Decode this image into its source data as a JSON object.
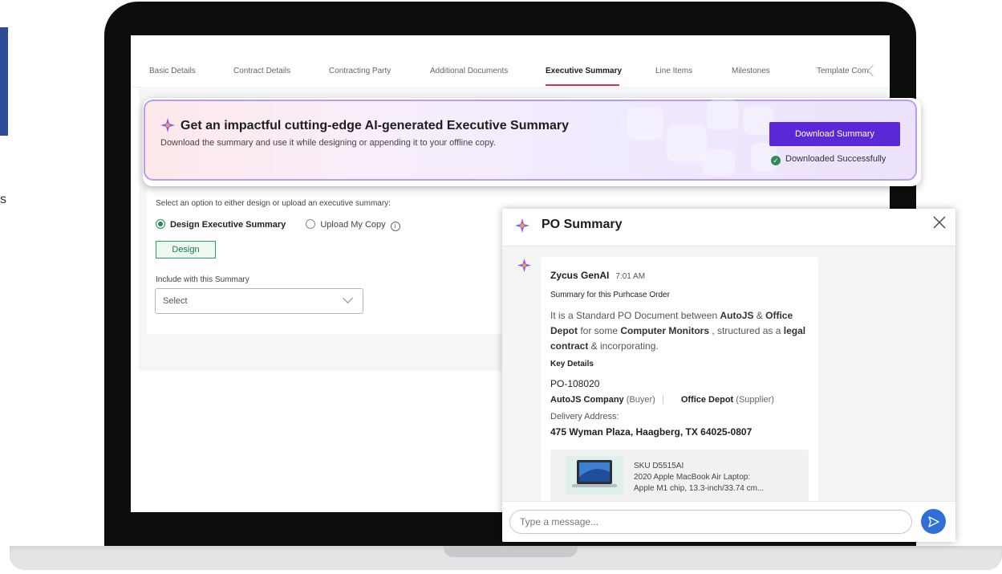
{
  "tabs": [
    {
      "label": "Basic Details"
    },
    {
      "label": "Contract Details"
    },
    {
      "label": "Contracting Party"
    },
    {
      "label": "Additional Documents"
    },
    {
      "label": "Executive Summary"
    },
    {
      "label": "Line Items"
    },
    {
      "label": "Milestones"
    },
    {
      "label": "Template Com"
    }
  ],
  "active_tab": "Executive Summary",
  "banner": {
    "title": "Get an impactful cutting-edge AI-generated Executive Summary",
    "subtitle": "Download the summary and use it while designing or appending it to your offline copy.",
    "download_label": "Download Summary",
    "status": "Downloaded Successfully"
  },
  "form": {
    "prompt": "Select an option to either design or upload an executive summary:",
    "option_design": "Design Executive Summary",
    "option_upload": "Upload My Copy",
    "selected_option": "Design Executive Summary",
    "design_label": "Design",
    "include_label": "Include with this Summary",
    "select_value": "Select"
  },
  "chat": {
    "title": "PO Summary",
    "sender": "Zycus GenAI",
    "time": "7:01 AM",
    "subtitle": "Summary for this Purhcase Order",
    "para": {
      "t1": "It is a Standard PO Document between ",
      "buyer_short": "AutoJS",
      "t2": " & ",
      "supplier_short": "Office Depot",
      "t3": " for some ",
      "item": "Computer Monitors",
      "t4": " , structured as a ",
      "doc_type": "legal contract",
      "t5": " & incorporating."
    },
    "key_details_label": "Key Details",
    "po_number": "PO-108020",
    "buyer_name": "AutoJS Company",
    "buyer_role": "(Buyer)",
    "supplier_name": "Office Depot",
    "supplier_role": "(Supplier)",
    "delivery_label": "Delivery Address:",
    "delivery_address": "475 Wyman Plaza, Haagberg, TX 64025-0807",
    "product": {
      "sku": "SKU D5515AI",
      "line1": "2020 Apple MacBook Air Laptop:",
      "line2": "Apple M1 chip, 13.3-inch/33.74 cm..."
    },
    "input_placeholder": "Type a message..."
  },
  "colors": {
    "accent_purple": "#5a28d6",
    "active_tab_underline": "#d9324a",
    "success_green": "#2e8b57",
    "send_blue": "#2f6fd6",
    "design_green": "#34a060"
  },
  "icons": [
    "ai-sparkle-icon",
    "check-circle-icon",
    "info-icon",
    "chevron-down-icon",
    "chevron-left-icon",
    "close-icon",
    "send-icon",
    "laptop-thumbnail"
  ]
}
